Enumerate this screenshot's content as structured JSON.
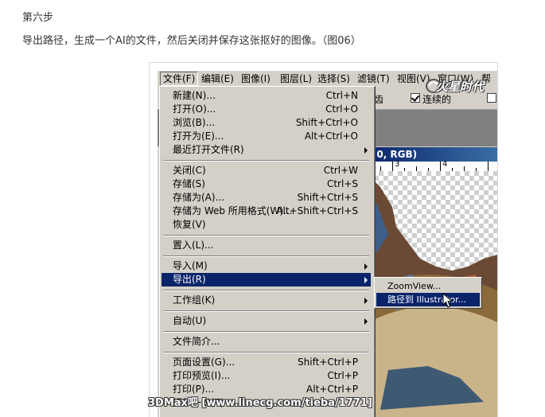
{
  "article": {
    "step_title": "第六步",
    "description": "导出路径，生成一个AI的文件，然后关闭并保存这张抠好的图像。（图06）"
  },
  "menubar": {
    "items": [
      {
        "label": "文件(F)"
      },
      {
        "label": "编辑(E)"
      },
      {
        "label": "图像(I)"
      },
      {
        "label": "图层(L)"
      },
      {
        "label": "选择(S)"
      },
      {
        "label": "滤镜(T)"
      },
      {
        "label": "视图(V)"
      },
      {
        "label": "窗口(W)"
      },
      {
        "label": "帮"
      }
    ]
  },
  "options_bar": {
    "antialias_label": "齿",
    "contiguous_label": "连续的"
  },
  "logo": {
    "text": "火星时代"
  },
  "document": {
    "title_fragment": "e 0, RGB)",
    "ruler_numbers": [
      "3",
      "4"
    ]
  },
  "file_menu": {
    "groups": [
      [
        {
          "label": "新建(N)...",
          "shortcut": "Ctrl+N"
        },
        {
          "label": "打开(O)...",
          "shortcut": "Ctrl+O"
        },
        {
          "label": "浏览(B)...",
          "shortcut": "Shift+Ctrl+O"
        },
        {
          "label": "打开为(E)...",
          "shortcut": "Alt+Ctrl+O"
        },
        {
          "label": "最近打开文件(R)",
          "shortcut": "",
          "submenu": true
        }
      ],
      [
        {
          "label": "关闭(C)",
          "shortcut": "Ctrl+W"
        },
        {
          "label": "存储(S)",
          "shortcut": "Ctrl+S"
        },
        {
          "label": "存储为(A)...",
          "shortcut": "Shift+Ctrl+S"
        },
        {
          "label": "存储为 Web 所用格式(W)...",
          "shortcut": "Alt+Shift+Ctrl+S"
        },
        {
          "label": "恢复(V)",
          "shortcut": ""
        }
      ],
      [
        {
          "label": "置入(L)...",
          "shortcut": ""
        }
      ],
      [
        {
          "label": "导入(M)",
          "shortcut": "",
          "submenu": true
        },
        {
          "label": "导出(R)",
          "shortcut": "",
          "submenu": true,
          "selected": true
        }
      ],
      [
        {
          "label": "工作组(K)",
          "shortcut": "",
          "submenu": true
        }
      ],
      [
        {
          "label": "自动(U)",
          "shortcut": "",
          "submenu": true
        }
      ],
      [
        {
          "label": "文件简介...",
          "shortcut": ""
        }
      ],
      [
        {
          "label": "页面设置(G)...",
          "shortcut": "Shift+Ctrl+P"
        },
        {
          "label": "打印预览(I)...",
          "shortcut": "Ctrl+P"
        },
        {
          "label": "打印(P)...",
          "shortcut": "Alt+Ctrl+P"
        },
        {
          "label": "打印一份(T)",
          "shortcut": ""
        }
      ]
    ]
  },
  "export_submenu": {
    "items": [
      {
        "label": "ZoomView..."
      },
      {
        "label": "路径到 Illustrator...",
        "selected": true
      }
    ]
  },
  "watermark": {
    "text": "3DMax吧 [www.linecg.com/tieba/1771]"
  },
  "colors": {
    "menu_face": "#d4d0c8",
    "selection": "#0a246a",
    "title_gradient_end": "#3a6ea5",
    "workspace_gray": "#808080"
  }
}
